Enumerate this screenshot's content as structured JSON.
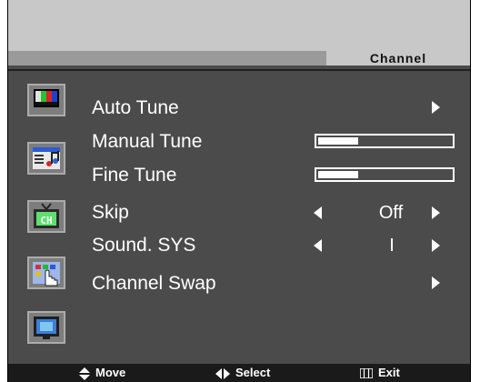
{
  "header": {
    "title": "Channel"
  },
  "menu": {
    "items": [
      {
        "label": "Auto Tune"
      },
      {
        "label": "Manual Tune",
        "progress": 0.3
      },
      {
        "label": "Fine Tune",
        "progress": 0.3
      },
      {
        "label": "Skip",
        "value": "Off"
      },
      {
        "label": "Sound. SYS",
        "value": "I"
      },
      {
        "label": "Channel Swap"
      }
    ]
  },
  "sidebar": {
    "icons": [
      "picture-icon",
      "sound-icon",
      "channel-icon",
      "function-icon",
      "screen-icon"
    ]
  },
  "footer": {
    "move_label": "Move",
    "select_label": "Select",
    "exit_label": "Exit"
  }
}
